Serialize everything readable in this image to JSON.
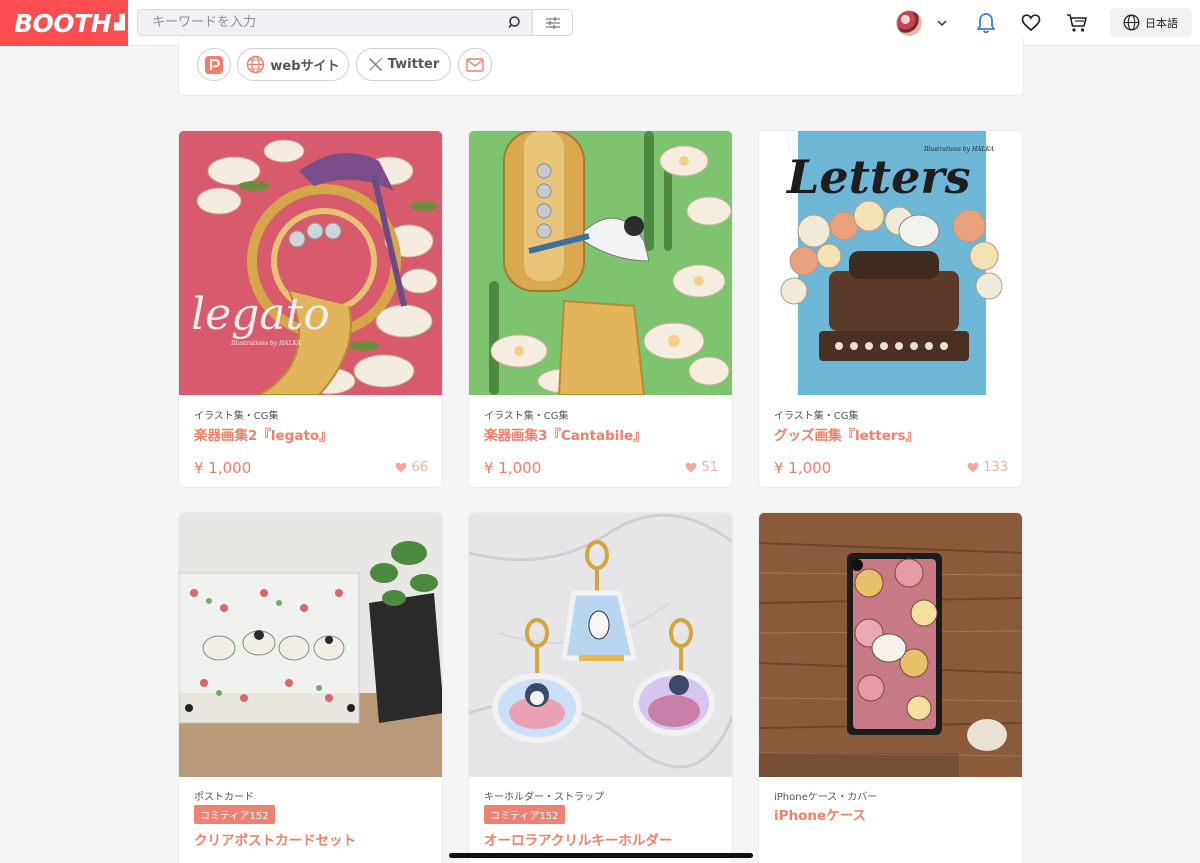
{
  "header": {
    "logo_text": "BOOTH",
    "search_placeholder": "キーワードを入力",
    "language_label": "日本語"
  },
  "colors": {
    "brand": "#fc4d50",
    "accent": "#f0806c",
    "badge": "#ee8074"
  },
  "profile_links": [
    {
      "icon": "pixiv-icon",
      "label": ""
    },
    {
      "icon": "globe-icon",
      "label": "webサイト"
    },
    {
      "icon": "x-icon",
      "label": "Twitter"
    },
    {
      "icon": "mail-icon",
      "label": ""
    }
  ],
  "products": [
    {
      "category": "イラスト集・CG集",
      "title": "楽器画集2『legato』",
      "price": "¥ 1,000",
      "likes": "66",
      "badge": ""
    },
    {
      "category": "イラスト集・CG集",
      "title": "楽器画集3『Cantabile』",
      "price": "¥ 1,000",
      "likes": "51",
      "badge": ""
    },
    {
      "category": "イラスト集・CG集",
      "title": "グッズ画集『letters』",
      "price": "¥ 1,000",
      "likes": "133",
      "badge": ""
    },
    {
      "category": "ポストカード",
      "title": "クリアポストカードセット",
      "price": "",
      "likes": "",
      "badge": "コミティア152"
    },
    {
      "category": "キーホルダー・ストラップ",
      "title": "オーロラアクリルキーホルダー",
      "price": "",
      "likes": "",
      "badge": "コミティア152"
    },
    {
      "category": "iPhoneケース・カバー",
      "title": "iPhoneケース",
      "price": "",
      "likes": "",
      "badge": ""
    }
  ],
  "artwork": {
    "legato_cover_text": "legato",
    "legato_cover_credit": "Illustrations by HALKA",
    "letters_cover_text": "Letters",
    "letters_cover_credit": "Illustrations by HALKA"
  }
}
